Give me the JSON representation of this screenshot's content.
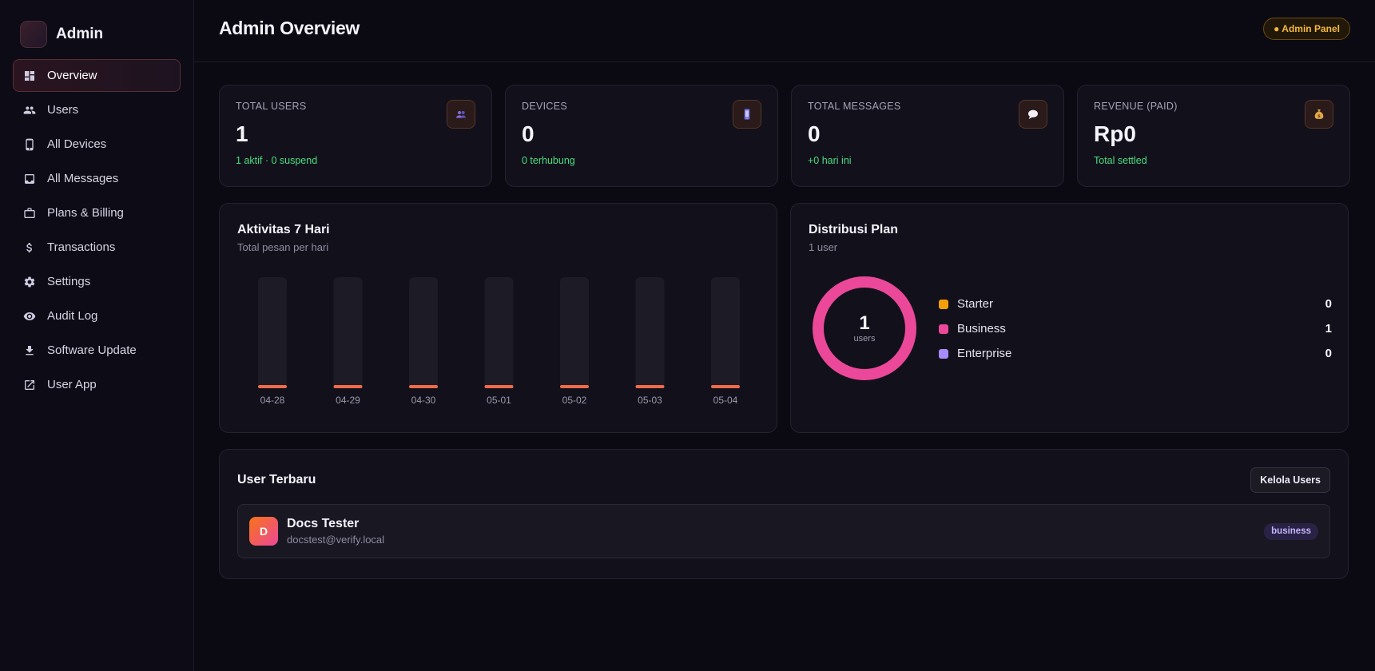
{
  "sidebar": {
    "brand": "Admin",
    "items": [
      {
        "label": "Overview",
        "icon": "dashboard-icon",
        "active": true
      },
      {
        "label": "Users",
        "icon": "users-icon"
      },
      {
        "label": "All Devices",
        "icon": "phone-icon"
      },
      {
        "label": "All Messages",
        "icon": "inbox-icon"
      },
      {
        "label": "Plans & Billing",
        "icon": "briefcase-icon"
      },
      {
        "label": "Transactions",
        "icon": "dollar-icon"
      },
      {
        "label": "Settings",
        "icon": "gear-icon"
      },
      {
        "label": "Audit Log",
        "icon": "eye-icon"
      },
      {
        "label": "Software Update",
        "icon": "download-icon"
      },
      {
        "label": "User App",
        "icon": "external-link-icon"
      }
    ]
  },
  "header": {
    "title": "Admin Overview",
    "badge": "● Admin Panel"
  },
  "stats": [
    {
      "label": "TOTAL USERS",
      "value": "1",
      "sub": "1 aktif · 0 suspend",
      "icon": "users-icon"
    },
    {
      "label": "DEVICES",
      "value": "0",
      "sub": "0 terhubung",
      "icon": "phone-icon"
    },
    {
      "label": "TOTAL MESSAGES",
      "value": "0",
      "sub": "+0 hari ini",
      "icon": "chat-bubble-icon"
    },
    {
      "label": "REVENUE (PAID)",
      "value": "Rp0",
      "sub": "Total settled",
      "icon": "money-bag-icon"
    }
  ],
  "activity": {
    "title": "Aktivitas 7 Hari",
    "subtitle": "Total pesan per hari"
  },
  "chart_data": {
    "type": "bar",
    "categories": [
      "04-28",
      "04-29",
      "04-30",
      "05-01",
      "05-02",
      "05-03",
      "05-04"
    ],
    "values": [
      0,
      0,
      0,
      0,
      0,
      0,
      0
    ],
    "title": "Aktivitas 7 Hari",
    "subtitle": "Total pesan per hari",
    "bar_color": "#ef6a4a",
    "track_color": "#1c1b26",
    "grid": false
  },
  "distribution": {
    "title": "Distribusi Plan",
    "subtitle": "1 user",
    "center_value": "1",
    "center_label": "users",
    "plans": [
      {
        "name": "Starter",
        "value": 0,
        "value_text": "0",
        "color": "#f59e0b"
      },
      {
        "name": "Business",
        "value": 1,
        "value_text": "1",
        "color": "#ec4899"
      },
      {
        "name": "Enterprise",
        "value": 0,
        "value_text": "0",
        "color": "#a78bfa"
      }
    ]
  },
  "recent_users": {
    "title": "User Terbaru",
    "manage_label": "Kelola Users",
    "users": [
      {
        "initial": "D",
        "name": "Docs Tester",
        "email": "docstest@verify.local",
        "plan": "business"
      }
    ]
  }
}
